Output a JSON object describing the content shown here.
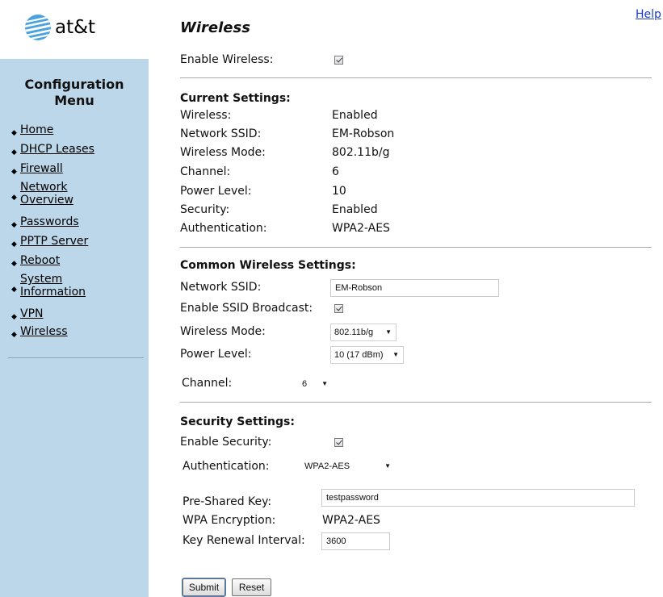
{
  "logo": {
    "text": "at&t"
  },
  "help_label": "Help",
  "page_title": "Wireless",
  "sidebar": {
    "title_line1": "Configuration",
    "title_line2": "Menu",
    "items": [
      {
        "line1": "Home",
        "line2": ""
      },
      {
        "line1": "DHCP Leases",
        "line2": ""
      },
      {
        "line1": "Firewall",
        "line2": ""
      },
      {
        "line1": "Network",
        "line2": "Overview"
      },
      {
        "line1": "Passwords",
        "line2": ""
      },
      {
        "line1": "PPTP Server",
        "line2": ""
      },
      {
        "line1": "Reboot",
        "line2": ""
      },
      {
        "line1": "System",
        "line2": "Information"
      },
      {
        "line1": "VPN",
        "line2": ""
      },
      {
        "line1": "Wireless",
        "line2": ""
      }
    ]
  },
  "enable_wireless": {
    "label": "Enable Wireless:",
    "checked": true
  },
  "current": {
    "heading": "Current Settings:",
    "rows": [
      {
        "label": "Wireless:",
        "value": "Enabled"
      },
      {
        "label": "Network SSID:",
        "value": "EM-Robson"
      },
      {
        "label": "Wireless Mode:",
        "value": "802.11b/g"
      },
      {
        "label": "Channel:",
        "value": "6"
      },
      {
        "label": "Power Level:",
        "value": "10"
      },
      {
        "label": "Security:",
        "value": "Enabled"
      },
      {
        "label": "Authentication:",
        "value": "WPA2-AES"
      }
    ]
  },
  "common": {
    "heading": "Common Wireless Settings:",
    "ssid_label": "Network SSID:",
    "ssid_value": "EM-Robson",
    "broadcast_label": "Enable SSID Broadcast:",
    "broadcast_checked": true,
    "mode_label": "Wireless Mode:",
    "mode_value": "802.11b/g",
    "power_label": "Power Level:",
    "power_value": "10 (17 dBm)",
    "channel_label": "Channel:",
    "channel_value": "6"
  },
  "security": {
    "heading": "Security Settings:",
    "enable_label": "Enable Security:",
    "enable_checked": true,
    "auth_label": "Authentication:",
    "auth_value": "WPA2-AES",
    "psk_label": "Pre-Shared Key:",
    "psk_value": "testpassword",
    "enc_label": "WPA Encryption:",
    "enc_value": "WPA2-AES",
    "renewal_label": "Key Renewal Interval:",
    "renewal_value": "3600"
  },
  "buttons": {
    "submit": "Submit",
    "reset": "Reset"
  },
  "icons": {
    "logo": "att-globe-icon",
    "checkbox": "checkmark-icon",
    "dropdown": "chevron-down-icon"
  }
}
